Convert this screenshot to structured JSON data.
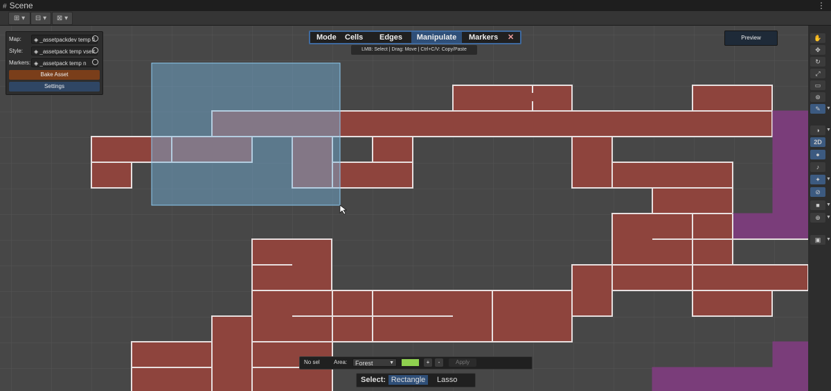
{
  "window": {
    "tab_title": "Scene",
    "menu_icon": "kebab-menu-icon"
  },
  "toolbar": {
    "tools": [
      "grid-snap-icon",
      "increment-snap-icon",
      "view-options-icon"
    ]
  },
  "map_panel": {
    "rows": [
      {
        "label": "Map:",
        "value": "_assetpackdev temp fi"
      },
      {
        "label": "Style:",
        "value": "_assetpack temp vsett"
      },
      {
        "label": "Markers:",
        "value": "_assetpack temp n"
      }
    ],
    "bake_label": "Bake Asset",
    "settings_label": "Settings"
  },
  "modebar": {
    "title": "Mode",
    "items": [
      "Cells",
      "Edges",
      "Manipulate",
      "Markers"
    ],
    "active": "Manipulate",
    "close": "✕"
  },
  "hint": "LMB: Select | Drag: Move | Ctrl+C/V: Copy/Paste",
  "preview_label": "Preview",
  "right_toolbar": {
    "view2d_label": "2D"
  },
  "bottom_panel": {
    "selection_label": "No sel",
    "area_label": "Area:",
    "area_value": "Forest",
    "area_color": "#8fd14f",
    "plus": "+",
    "minus": "-",
    "apply_label": "Apply"
  },
  "select_panel": {
    "label": "Select:",
    "options": [
      "Rectangle",
      "Lasso"
    ],
    "active": "Rectangle"
  },
  "colors": {
    "room": "#8e443d",
    "room_alt": "#7a3d7a",
    "selection": "#76b6e0",
    "accent": "#3e6aa0"
  }
}
